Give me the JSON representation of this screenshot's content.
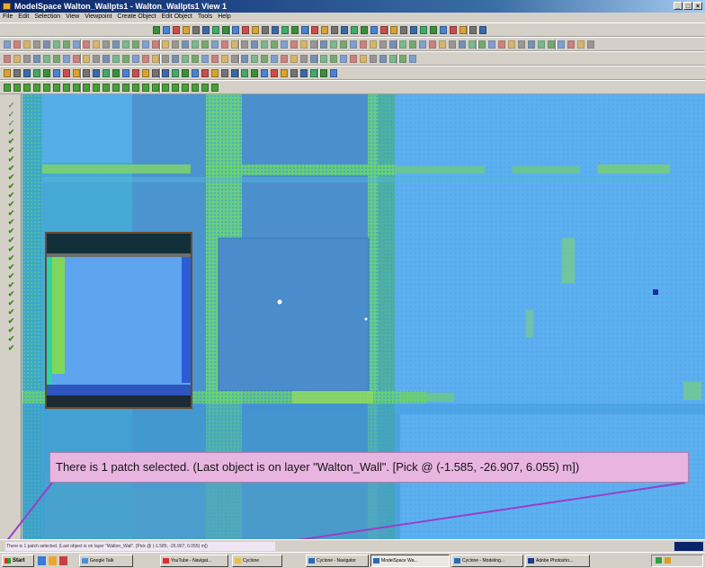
{
  "window": {
    "title": "ModelSpace Walton_Wallpts1 - Walton_Wallpts1 View 1"
  },
  "menu": {
    "items": [
      "File",
      "Edit",
      "Selection",
      "View",
      "Viewpoint",
      "Create Object",
      "Edit Object",
      "Tools",
      "Help"
    ]
  },
  "viewport": {
    "callout_text": "There is 1 patch selected. (Last object is on layer \"Walton_Wall\". [Pick @ (-1.585, -26.907, 6.055) m])"
  },
  "statusbar": {
    "message": "There is 1 patch selected. (Last object is on layer \"Walton_Wall\". [Pick @ (-1.585, -26.907, 6.055) m])"
  },
  "taskbar": {
    "start_label": "Start",
    "tasks": [
      {
        "label": "Google Talk",
        "active": false
      },
      {
        "label": "YouTube - Navigat...",
        "active": false
      },
      {
        "label": "Cyclone",
        "active": false
      },
      {
        "label": "Cyclone - Navigator",
        "active": false
      },
      {
        "label": "ModelSpace Wa...",
        "active": true
      },
      {
        "label": "Cyclone - Modeling...",
        "active": false
      },
      {
        "label": "Adobe Photosho...",
        "active": false
      }
    ]
  },
  "colors": {
    "viewport_blue": "#5aa8ec",
    "point_cloud_green": "#6fd36a",
    "callout_pink": "#e8b4e0",
    "leader_line": "#9a3ec8",
    "titlebar": "#0a246a"
  }
}
